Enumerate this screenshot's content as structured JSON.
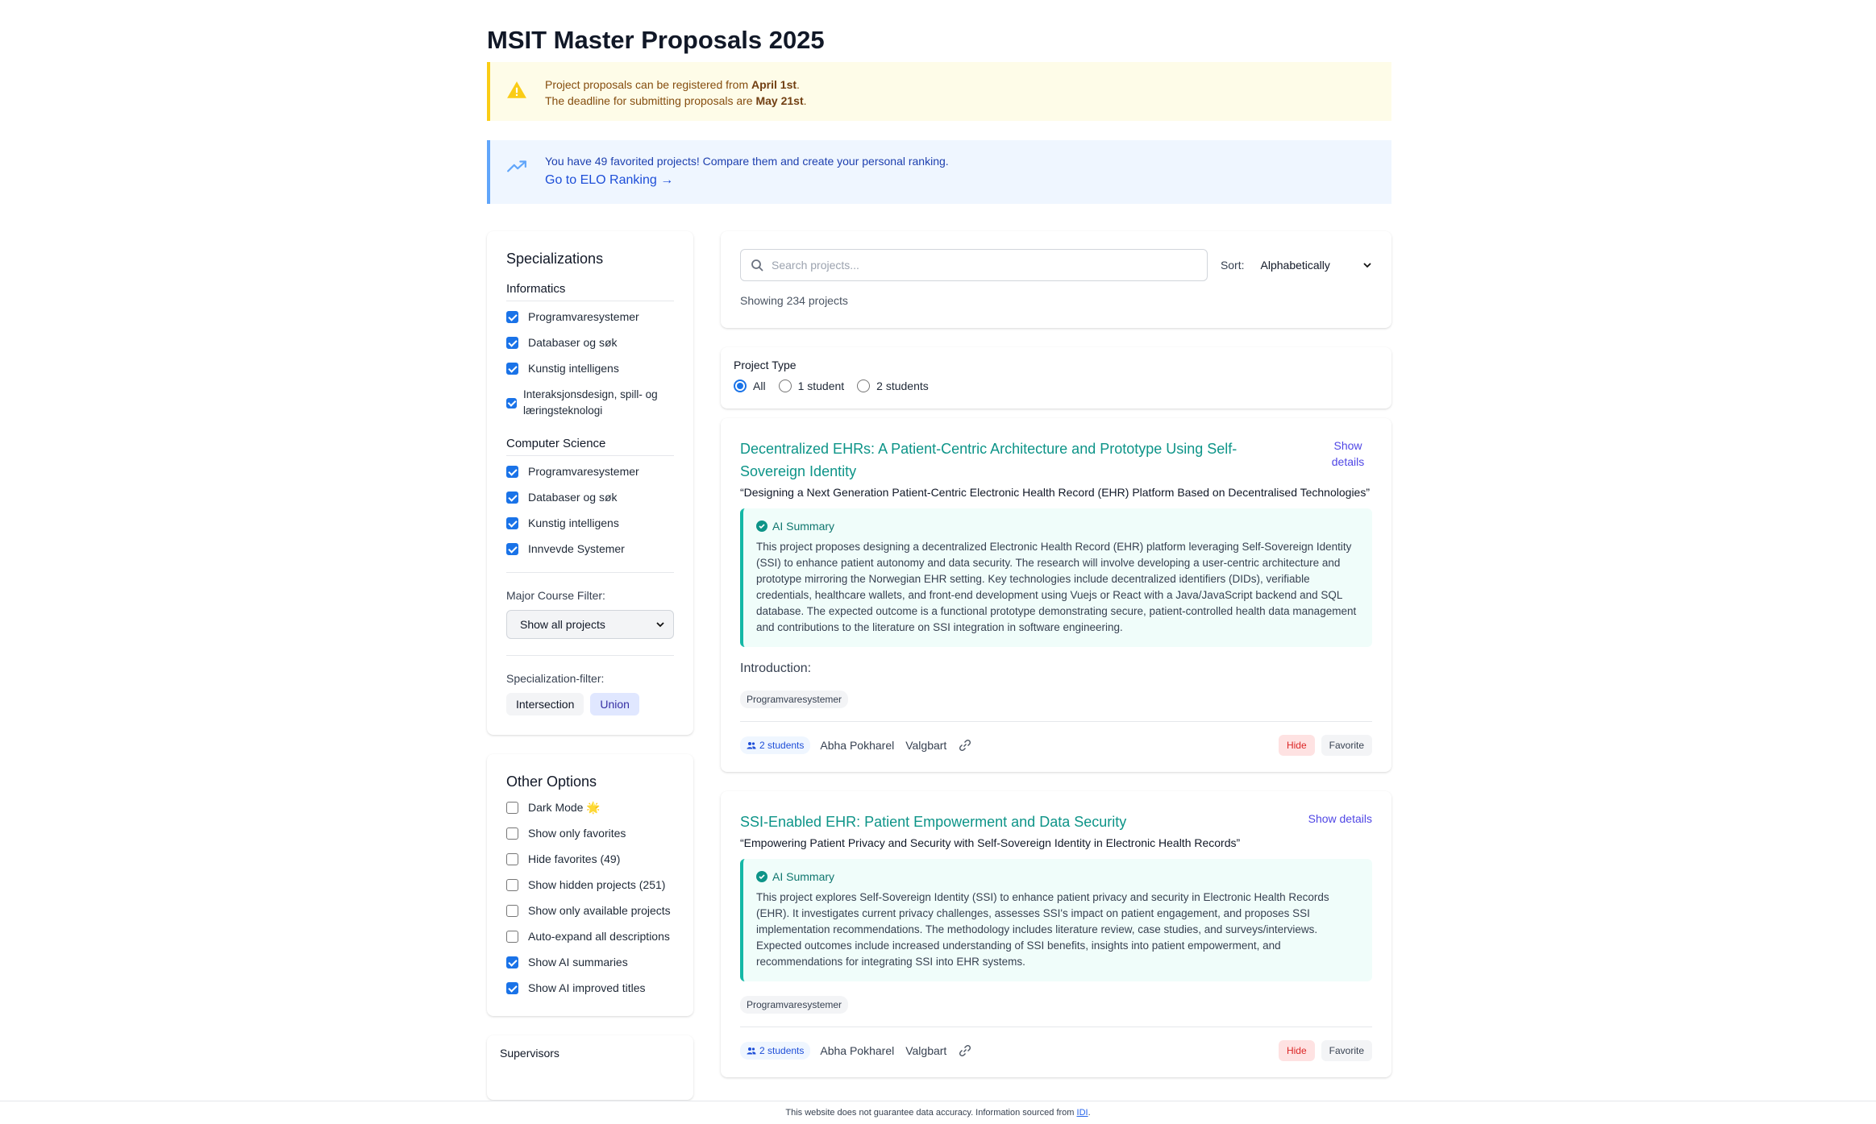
{
  "page_title": "MSIT Master Proposals 2025",
  "warning": {
    "line1_prefix": "Project proposals can be registered from ",
    "line1_bold": "April 1st",
    "line1_suffix": ".",
    "line2_prefix": "The deadline for submitting proposals are ",
    "line2_bold": "May 21st",
    "line2_suffix": "."
  },
  "info": {
    "text": "You have 49 favorited projects! Compare them and create your personal ranking.",
    "link": "Go to ELO Ranking →"
  },
  "specializations": {
    "heading": "Specializations",
    "groups": [
      {
        "name": "Informatics",
        "items": [
          {
            "label": "Programvaresystemer",
            "checked": true
          },
          {
            "label": "Databaser og søk",
            "checked": true
          },
          {
            "label": "Kunstig intelligens",
            "checked": true
          },
          {
            "label": "Interaksjonsdesign, spill- og læringsteknologi",
            "checked": true
          }
        ]
      },
      {
        "name": "Computer Science",
        "items": [
          {
            "label": "Programvaresystemer",
            "checked": true
          },
          {
            "label": "Databaser og søk",
            "checked": true
          },
          {
            "label": "Kunstig intelligens",
            "checked": true
          },
          {
            "label": "Innvevde Systemer",
            "checked": true
          }
        ]
      }
    ],
    "major_filter_label": "Major Course Filter:",
    "major_filter_value": "Show all projects",
    "spec_filter_label": "Specialization-filter:",
    "spec_filter_options": [
      "Intersection",
      "Union"
    ],
    "spec_filter_active": "Union"
  },
  "other_options": {
    "heading": "Other Options",
    "items": [
      {
        "label": "Dark Mode 🌟",
        "checked": false
      },
      {
        "label": "Show only favorites",
        "checked": false
      },
      {
        "label": "Hide favorites (49)",
        "checked": false
      },
      {
        "label": "Show hidden projects (251)",
        "checked": false
      },
      {
        "label": "Show only available projects",
        "checked": false
      },
      {
        "label": "Auto-expand all descriptions",
        "checked": false
      },
      {
        "label": "Show AI summaries",
        "checked": true
      },
      {
        "label": "Show AI improved titles",
        "checked": true
      }
    ]
  },
  "supervisors_heading": "Supervisors",
  "search": {
    "placeholder": "Search projects...",
    "sort_label": "Sort:",
    "sort_value": "Alphabetically",
    "count_text": "Showing 234 projects"
  },
  "project_type": {
    "heading": "Project Type",
    "options": [
      "All",
      "1 student",
      "2 students"
    ],
    "selected": "All"
  },
  "projects": [
    {
      "title": "Decentralized EHRs: A Patient-Centric Architecture and Prototype Using Self-Sovereign Identity",
      "show_details": "Show details",
      "subtitle": "“Designing a Next Generation Patient-Centric Electronic Health Record (EHR) Platform Based on Decentralised Technologies”",
      "ai_label": "AI Summary",
      "ai_text": "This project proposes designing a decentralized Electronic Health Record (EHR) platform leveraging Self-Sovereign Identity (SSI) to enhance patient autonomy and data security. The research will involve developing a user-centric architecture and prototype mirroring the Norwegian EHR setting. Key technologies include decentralized identifiers (DIDs), verifiable credentials, healthcare wallets, and front-end development using Vuejs or React with a Java/JavaScript backend and SQL database. The expected outcome is a functional prototype demonstrating secure, patient-controlled health data management and contributions to the literature on SSI integration in software engineering.",
      "intro": "Introduction:",
      "tag": "Programvaresystemer",
      "students": "2 students",
      "supervisor": "Abha Pokharel",
      "status": "Valgbart",
      "hide": "Hide",
      "favorite": "Favorite"
    },
    {
      "title": "SSI-Enabled EHR: Patient Empowerment and Data Security",
      "show_details": "Show details",
      "subtitle": "“Empowering Patient Privacy and Security with Self-Sovereign Identity in Electronic Health Records”",
      "ai_label": "AI Summary",
      "ai_text": "This project explores Self-Sovereign Identity (SSI) to enhance patient privacy and security in Electronic Health Records (EHR). It investigates current privacy challenges, assesses SSI's impact on patient engagement, and proposes SSI implementation recommendations. The methodology includes literature review, case studies, and surveys/interviews. Expected outcomes include increased understanding of SSI benefits, insights into patient empowerment, and recommendations for integrating SSI into EHR systems.",
      "tag": "Programvaresystemer",
      "students": "2 students",
      "supervisor": "Abha Pokharel",
      "status": "Valgbart",
      "hide": "Hide",
      "favorite": "Favorite"
    }
  ],
  "footer": {
    "text": "This website does not guarantee data accuracy. Information sourced from ",
    "link": "IDI",
    "suffix": "."
  }
}
